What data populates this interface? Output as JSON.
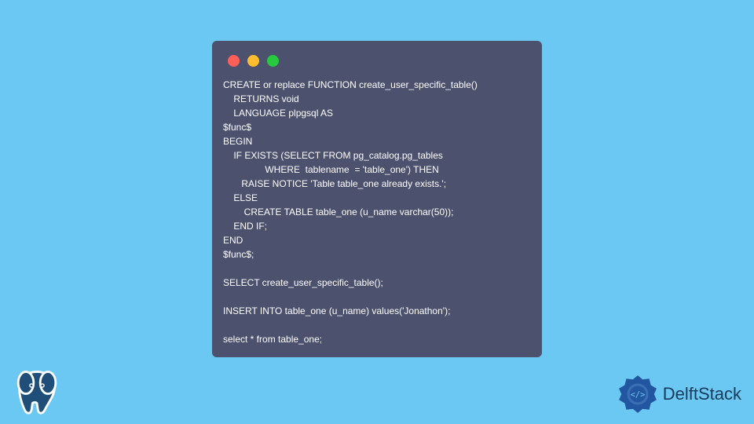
{
  "code": {
    "lines": [
      "CREATE or replace FUNCTION create_user_specific_table()",
      "    RETURNS void",
      "    LANGUAGE plpgsql AS",
      "$func$",
      "BEGIN",
      "    IF EXISTS (SELECT FROM pg_catalog.pg_tables",
      "                WHERE  tablename  = 'table_one') THEN",
      "       RAISE NOTICE 'Table table_one already exists.';",
      "    ELSE",
      "        CREATE TABLE table_one (u_name varchar(50));",
      "    END IF;",
      "END",
      "$func$;",
      "",
      "SELECT create_user_specific_table();",
      "",
      "INSERT INTO table_one (u_name) values('Jonathon');",
      "",
      "select * from table_one;"
    ]
  },
  "branding": {
    "name": "DelftStack"
  }
}
